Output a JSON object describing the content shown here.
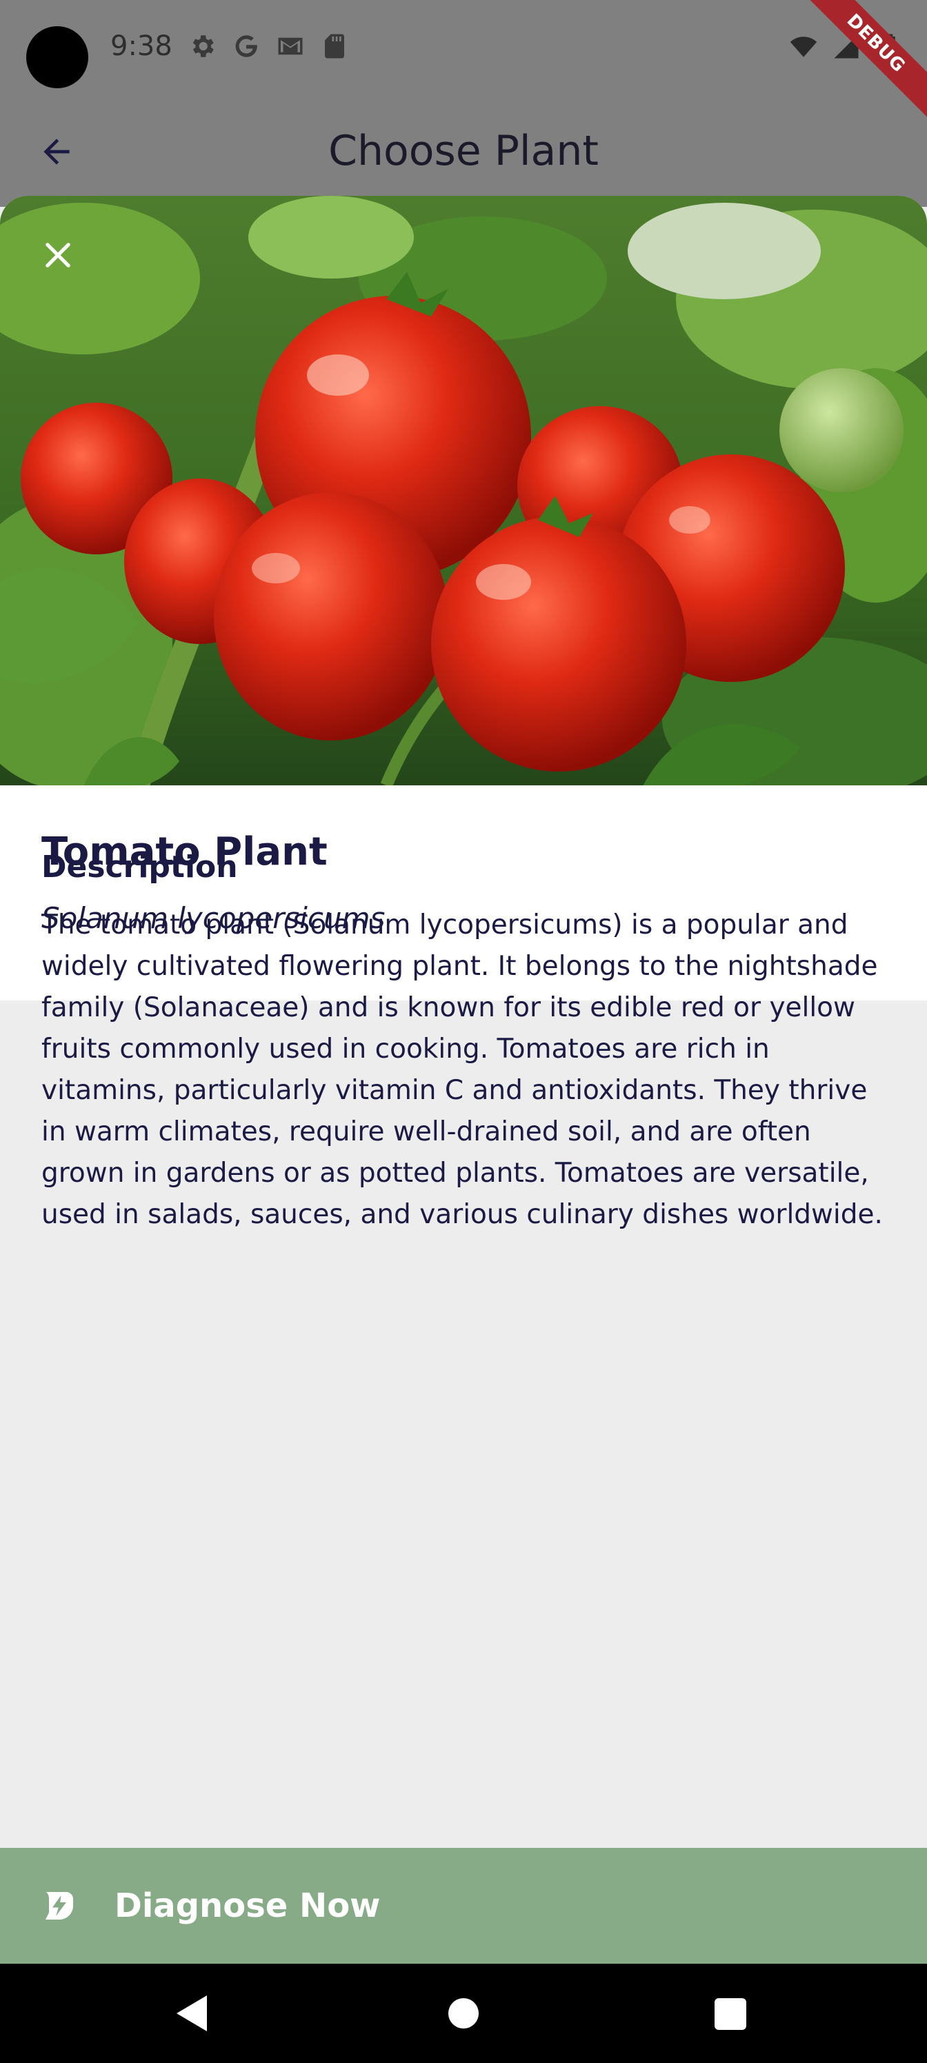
{
  "status_bar": {
    "time": "9:38",
    "left_icons": [
      "settings-icon",
      "google-icon",
      "gmail-icon",
      "sd-card-icon"
    ],
    "right_icons": [
      "wifi-icon",
      "signal-icon",
      "battery-icon"
    ]
  },
  "debug_banner": "DEBUG",
  "app_bar": {
    "title": "Choose Plant",
    "back_icon": "arrow-back-icon"
  },
  "hero": {
    "image": "tomato-plant-photo",
    "close_icon": "close-icon"
  },
  "plant": {
    "name": "Tomato Plant",
    "scientific_name": "Solanum lycopersicums"
  },
  "description": {
    "heading": "Description",
    "text": "The tomato plant (Solanum lycopersicums) is a popular and widely cultivated flowering plant. It belongs to the nightshade family (Solanaceae) and is known for its edible red or yellow fruits commonly used in cooking. Tomatoes are rich in vitamins, particularly vitamin C and antioxidants. They thrive in warm climates, require well-drained soil, and are often grown in gardens or as potted plants. Tomatoes are versatile, used in salads, sauces, and various culinary dishes worldwide."
  },
  "action": {
    "label": "Diagnose Now",
    "icon": "diagnose-leaf-icon",
    "color": "#87ab86"
  },
  "nav_bar": {
    "icons": [
      "nav-back-icon",
      "nav-home-icon",
      "nav-recents-icon"
    ]
  },
  "colors": {
    "text": "#1b1a44",
    "backdrop": "#808080",
    "sheet": "#ededed",
    "card": "#ffffff",
    "debug": "#a8262b"
  }
}
